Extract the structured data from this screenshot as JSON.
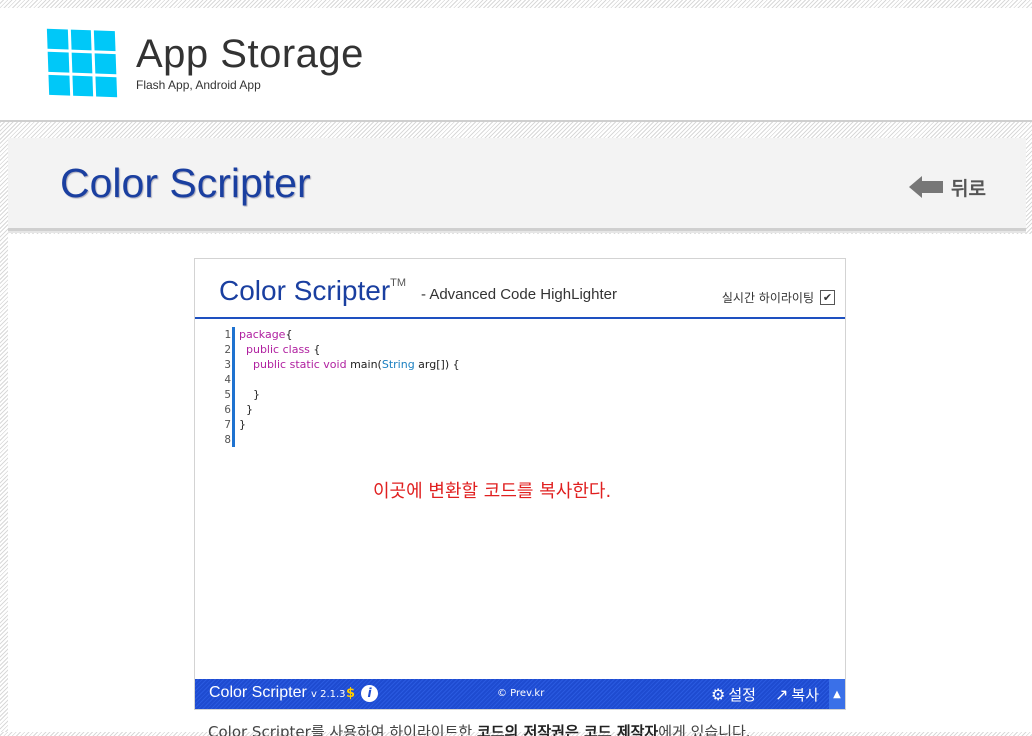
{
  "header": {
    "title": "App Storage",
    "subtitle": "Flash App, Android App",
    "logo_icon": "windows-tiles-icon",
    "logo_color": "#00c8f8"
  },
  "title_bar": {
    "page_title": "Color Scripter",
    "back_label": "뒤로",
    "back_icon": "arrow-left-icon"
  },
  "widget": {
    "logo_text": "Color Scripter",
    "trademark": "TM",
    "tagline": "- Advanced Code HighLighter",
    "realtime_label": "실시간 하이라이팅",
    "realtime_checked": true,
    "line_numbers": [
      "1",
      "2",
      "3",
      "4",
      "5",
      "6",
      "7",
      "8"
    ],
    "hint": "이곳에 변환할 코드를 복사한다.",
    "footer": {
      "name": "Color Scripter",
      "version": "v 2.1.3",
      "dollar": "$",
      "info": "i",
      "copyright": "© Prev.kr",
      "settings_label": "설정",
      "copy_label": "복사",
      "scroll_up": "▲"
    }
  },
  "bottom_note": {
    "prefix": "Color Scripter를 사용하여 하이라이트한",
    "bold1": "코드의 저작권은 코드 제작자",
    "suffix": "에게 있습니다."
  },
  "colors": {
    "accent_blue": "#1a3fa0",
    "footer_blue": "#1e4bd0",
    "hint_red": "#e02020",
    "keyword": "#b020a0",
    "type": "#1a7fc0"
  }
}
